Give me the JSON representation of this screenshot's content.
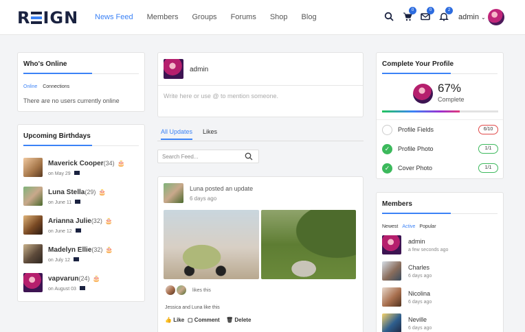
{
  "header": {
    "logo": "REIGN",
    "nav": [
      "News Feed",
      "Members",
      "Groups",
      "Forums",
      "Shop",
      "Blog"
    ],
    "cart_count": "0",
    "messages_count": "0",
    "notifications_count": "2",
    "user": "admin"
  },
  "whos_online": {
    "title": "Who's Online",
    "tabs": [
      "Online",
      "Connections"
    ],
    "message": "There are no users currently online"
  },
  "birthdays": {
    "title": "Upcoming Birthdays",
    "people": [
      {
        "name": "Maverick Cooper",
        "age": "(34)",
        "date": "on May 29"
      },
      {
        "name": "Luna Stella",
        "age": "(29)",
        "date": "on June 11"
      },
      {
        "name": "Arianna Julie",
        "age": "(32)",
        "date": "on June 12"
      },
      {
        "name": "Madelyn Ellie",
        "age": "(32)",
        "date": "on July 12"
      },
      {
        "name": "vapvarun",
        "age": "(24)",
        "date": "on August 03"
      }
    ]
  },
  "composer": {
    "user": "admin",
    "placeholder": "Write here or use @ to mention someone."
  },
  "feed": {
    "tabs": [
      "All Updates",
      "Likes"
    ],
    "search_placeholder": "Search Feed...",
    "post": {
      "author": "Luna",
      "action": "posted an update",
      "time": "6 days ago",
      "likes_label": "likes this",
      "liked_by": "Jessica and Luna like this",
      "actions": [
        "Like",
        "Comment",
        "Delete"
      ]
    }
  },
  "profile": {
    "title": "Complete Your Profile",
    "percent": "67%",
    "percent_label": "Complete",
    "progress": 0.67,
    "items": [
      {
        "label": "Profile Fields",
        "status": "6/10",
        "done": false
      },
      {
        "label": "Profile Photo",
        "status": "1/1",
        "done": true
      },
      {
        "label": "Cover Photo",
        "status": "1/1",
        "done": true
      }
    ]
  },
  "members": {
    "title": "Members",
    "tabs": [
      "Newest",
      "Active",
      "Popular"
    ],
    "list": [
      {
        "name": "admin",
        "ago": "a few seconds ago"
      },
      {
        "name": "Charles",
        "ago": "6 days ago"
      },
      {
        "name": "Nicolina",
        "ago": "6 days ago"
      },
      {
        "name": "Neville",
        "ago": "6 days ago"
      }
    ]
  },
  "colors": {
    "accent": "#3b82f6",
    "success": "#3cb95c",
    "danger": "#e04848",
    "brand": "#1a2240"
  }
}
